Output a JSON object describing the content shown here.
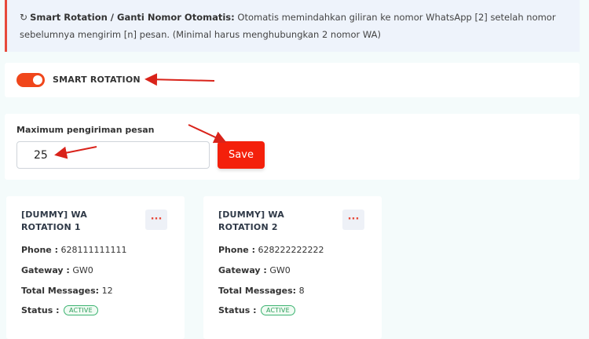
{
  "info": {
    "title": "Smart Rotation / Ganti Nomor Otomatis:",
    "text": " Otomatis memindahkan giliran ke nomor WhatsApp [2] setelah nomor sebelumnya mengirim [n] pesan. (Minimal harus menghubungkan 2 nomor WA)",
    "icon": "rotate-icon"
  },
  "smart_rotation": {
    "label": "SMART ROTATION",
    "enabled": true
  },
  "max_sending": {
    "label": "Maximum pengiriman pesan",
    "value": "25",
    "save_label": "Save"
  },
  "wa_cards": [
    {
      "title": "[DUMMY] WA ROTATION 1",
      "menu_label": "···",
      "phone_label": "Phone :",
      "phone": " 628111111111",
      "gateway_label": "Gateway :",
      "gateway": " GW0",
      "messages_label": "Total Messages:",
      "messages": " 12",
      "status_label": "Status :",
      "status": "ACTIVE"
    },
    {
      "title": "[DUMMY] WA ROTATION 2",
      "menu_label": "···",
      "phone_label": "Phone :",
      "phone": " 628222222222",
      "gateway_label": "Gateway :",
      "gateway": " GW0",
      "messages_label": "Total Messages:",
      "messages": " 8",
      "status_label": "Status :",
      "status": "ACTIVE"
    }
  ],
  "colors": {
    "accent": "#f4200b",
    "toggle": "#f0461b",
    "status_green": "#3cb371"
  }
}
